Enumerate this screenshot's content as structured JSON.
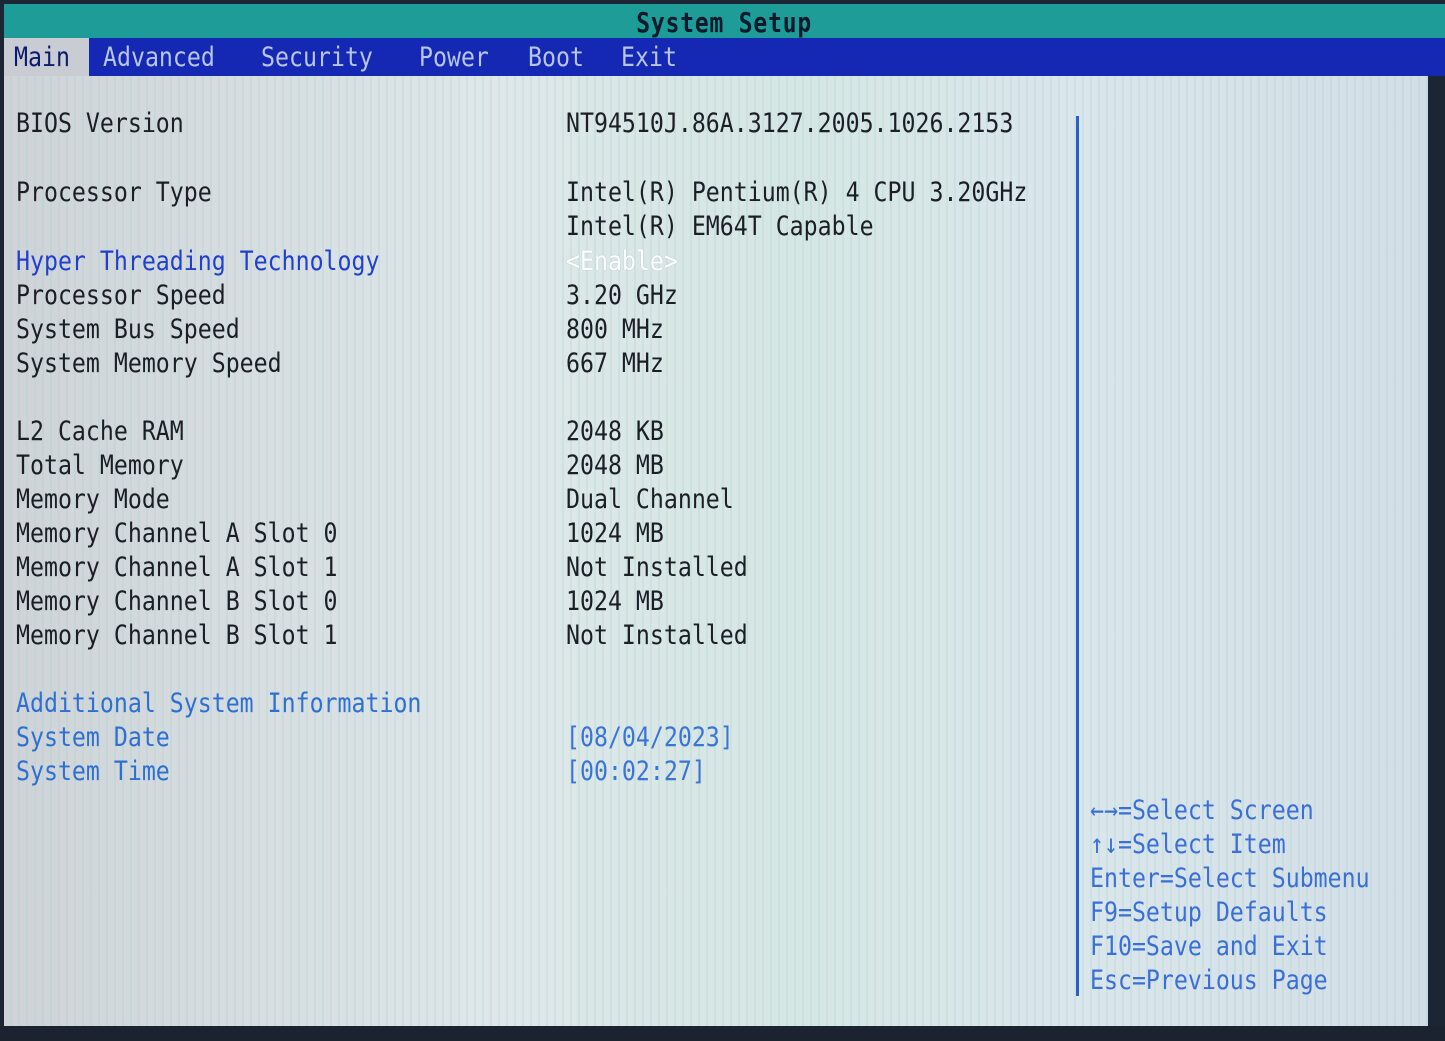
{
  "title": "System Setup",
  "menu": [
    {
      "label": "Main",
      "active": true
    },
    {
      "label": "Advanced",
      "active": false
    },
    {
      "label": "Security",
      "active": false
    },
    {
      "label": "Power",
      "active": false
    },
    {
      "label": "Boot",
      "active": false
    },
    {
      "label": "Exit",
      "active": false
    }
  ],
  "items": {
    "bios_version": {
      "label": "BIOS Version",
      "value": "NT94510J.86A.3127.2005.1026.2153"
    },
    "processor_type": {
      "label": "Processor Type",
      "value": "Intel(R) Pentium(R) 4 CPU 3.20GHz",
      "value2": "Intel(R) EM64T Capable"
    },
    "hyper_threading": {
      "label": "Hyper Threading Technology",
      "value": "<Enable>"
    },
    "processor_speed": {
      "label": "Processor Speed",
      "value": "3.20 GHz"
    },
    "bus_speed": {
      "label": "System Bus Speed",
      "value": "800 MHz"
    },
    "memory_speed": {
      "label": "System Memory Speed",
      "value": "667 MHz"
    },
    "l2_cache": {
      "label": "L2 Cache RAM",
      "value": "2048 KB"
    },
    "total_memory": {
      "label": "Total Memory",
      "value": "2048 MB"
    },
    "memory_mode": {
      "label": "Memory Mode",
      "value": "Dual Channel"
    },
    "chan_a_slot0": {
      "label": "Memory Channel A Slot 0",
      "value": "1024 MB"
    },
    "chan_a_slot1": {
      "label": "Memory Channel A Slot 1",
      "value": "Not Installed"
    },
    "chan_b_slot0": {
      "label": "Memory Channel B Slot 0",
      "value": "1024 MB"
    },
    "chan_b_slot1": {
      "label": "Memory Channel B Slot 1",
      "value": "Not Installed"
    },
    "additional_info": {
      "label": "Additional System Information"
    },
    "system_date": {
      "label": "System Date",
      "value": "[08/04/2023]"
    },
    "system_time": {
      "label": "System Time",
      "value": "[00:02:27]"
    }
  },
  "help": [
    "←→=Select Screen",
    "↑↓=Select Item",
    "Enter=Select Submenu",
    "F9=Setup Defaults",
    "F10=Save and Exit",
    "Esc=Previous Page"
  ],
  "colors": {
    "title_bar": "#1e9c97",
    "menu_bar": "#1428b4",
    "selectable_text": "#1f3fcc",
    "help_text": "#3a6fd6",
    "divider": "#2b5fc8"
  }
}
